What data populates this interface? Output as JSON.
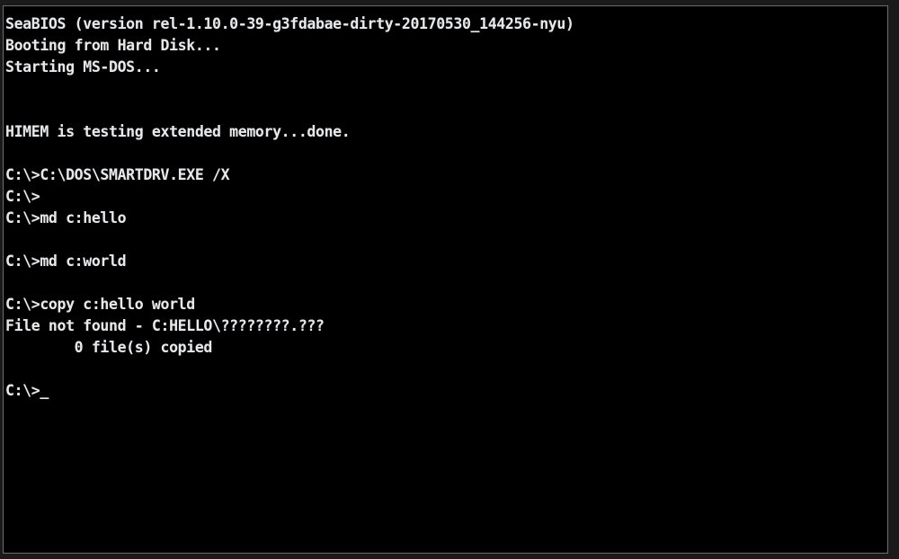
{
  "window": {
    "name": "qemu-dos-console",
    "outer_background": "#1a1a1a",
    "frame_border_color": "#6d6d6d",
    "screen_background": "#000000",
    "text_color": "#e8e8e8"
  },
  "console": {
    "prompt": "C:\\>",
    "cursor": "_",
    "lines": [
      {
        "id": "bios-banner",
        "text": "SeaBIOS (version rel-1.10.0-39-g3fdabae-dirty-20170530_144256-nyu)"
      },
      {
        "id": "boot-device",
        "text": "Booting from Hard Disk..."
      },
      {
        "id": "starting-msdos",
        "text": "Starting MS-DOS..."
      },
      {
        "id": "blank-1",
        "text": ""
      },
      {
        "id": "blank-2",
        "text": ""
      },
      {
        "id": "himem-status",
        "text": "HIMEM is testing extended memory...done."
      },
      {
        "id": "blank-3",
        "text": ""
      },
      {
        "id": "cmd-smartdrv",
        "text": "C:\\>C:\\DOS\\SMARTDRV.EXE /X"
      },
      {
        "id": "prompt-empty",
        "text": "C:\\>"
      },
      {
        "id": "cmd-md-hello",
        "text": "C:\\>md c:hello"
      },
      {
        "id": "blank-4",
        "text": ""
      },
      {
        "id": "cmd-md-world",
        "text": "C:\\>md c:world"
      },
      {
        "id": "blank-5",
        "text": ""
      },
      {
        "id": "cmd-copy",
        "text": "C:\\>copy c:hello world"
      },
      {
        "id": "error-file-not-found",
        "text": "File not found - C:HELLO\\????????.???"
      },
      {
        "id": "copy-count",
        "text": "        0 file(s) copied"
      },
      {
        "id": "blank-6",
        "text": ""
      },
      {
        "id": "prompt-active",
        "text": "C:\\>_"
      }
    ]
  }
}
